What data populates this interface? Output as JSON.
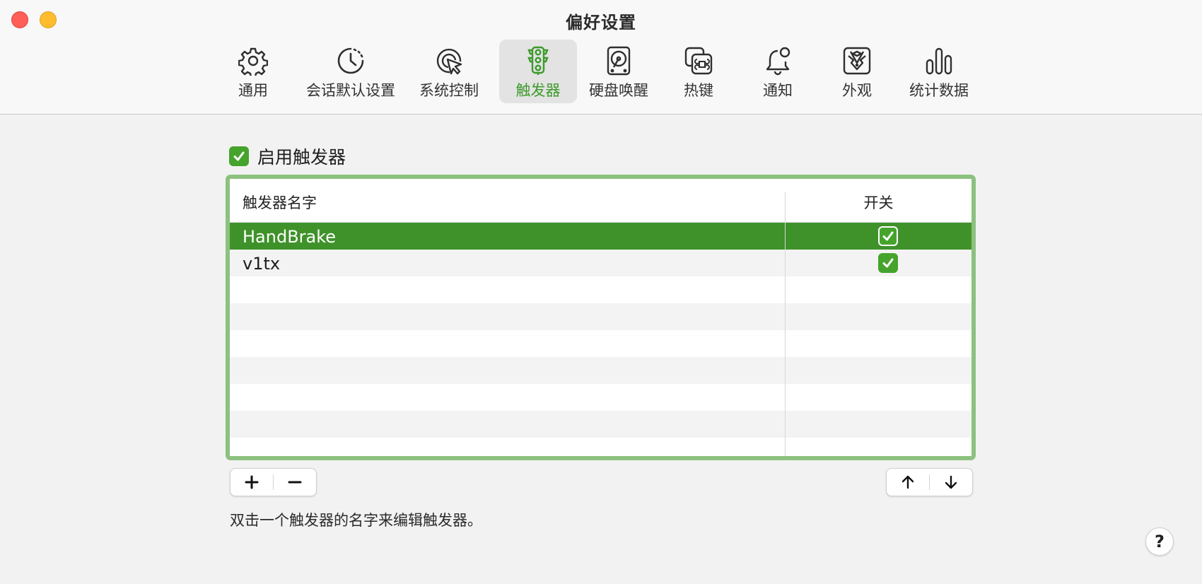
{
  "window": {
    "title": "偏好设置"
  },
  "toolbar": {
    "items": [
      {
        "label": "通用",
        "icon": "gear-icon"
      },
      {
        "label": "会话默认设置",
        "icon": "clock-icon"
      },
      {
        "label": "系统控制",
        "icon": "cursor-target-icon"
      },
      {
        "label": "触发器",
        "icon": "traffic-light-icon",
        "selected": true
      },
      {
        "label": "硬盘唤醒",
        "icon": "hard-drive-icon"
      },
      {
        "label": "热键",
        "icon": "command-key-icon"
      },
      {
        "label": "通知",
        "icon": "bell-icon"
      },
      {
        "label": "外观",
        "icon": "tuxedo-icon"
      },
      {
        "label": "统计数据",
        "icon": "bar-chart-icon"
      }
    ]
  },
  "enable": {
    "label": "启用触发器",
    "checked": true
  },
  "table": {
    "columns": {
      "name": "触发器名字",
      "toggle": "开关"
    },
    "rows": [
      {
        "name": "HandBrake",
        "enabled": true,
        "selected": true
      },
      {
        "name": "v1tx",
        "enabled": true,
        "selected": false
      }
    ]
  },
  "controls": {
    "add_icon": "plus-icon",
    "remove_icon": "minus-icon",
    "up_icon": "arrow-up-icon",
    "down_icon": "arrow-down-icon"
  },
  "hint": "双击一个触发器的名字来编辑触发器。",
  "help": "?",
  "colors": {
    "accent": "#3f922a",
    "frame": "#8cc17f",
    "close": "#fe5f57",
    "minimize": "#febc2e"
  }
}
